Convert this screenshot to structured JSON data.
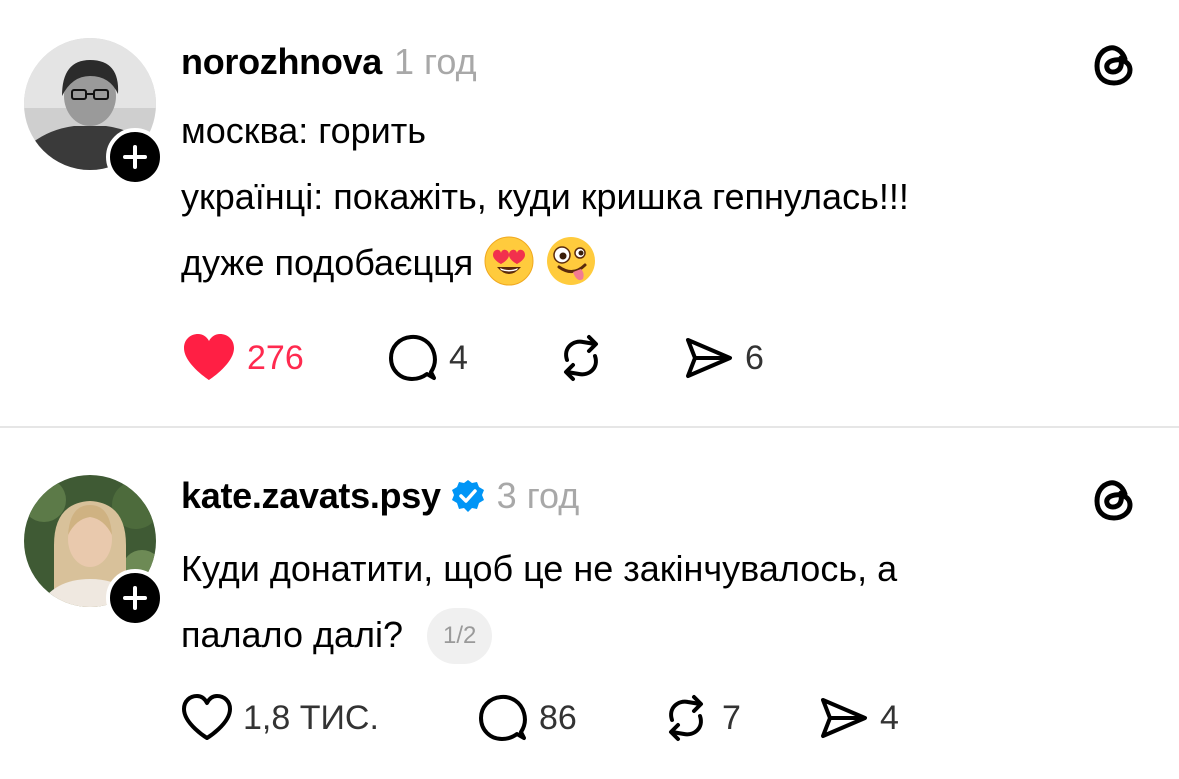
{
  "posts": [
    {
      "username": "norozhnova",
      "time": "1 год",
      "verified": false,
      "lines": [
        "москва: горить",
        "українці: покажіть, куди кришка гепнулась!!!",
        "дуже подобаєцця"
      ],
      "emojis": [
        "heart-eyes-emoji",
        "zany-face-emoji"
      ],
      "likes": "276",
      "liked": true,
      "replies": "4",
      "reposts": "",
      "shares": "6",
      "colors": {
        "like_active": "#ff2a4f"
      }
    },
    {
      "username": "kate.zavats.psy",
      "time": "3 год",
      "verified": true,
      "lines": [
        "Куди донатити, щоб це не закінчувалось, а",
        "палало далі?"
      ],
      "page_indicator": "1/2",
      "likes": "1,8 ТИС.",
      "liked": false,
      "replies": "86",
      "reposts": "7",
      "shares": "4",
      "colors": {
        "verified": "#0095f6"
      }
    }
  ]
}
